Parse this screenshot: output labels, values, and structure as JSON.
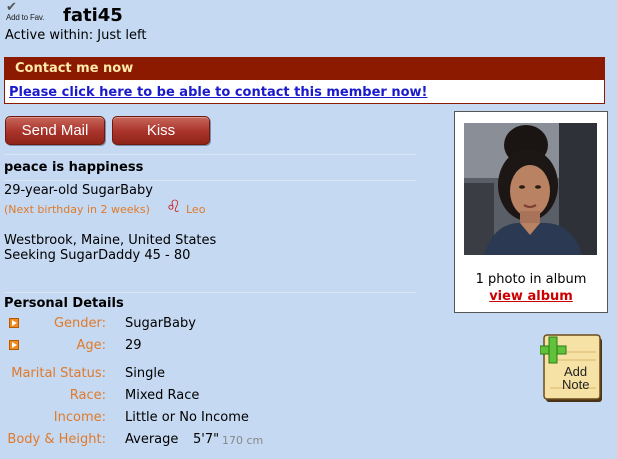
{
  "header": {
    "fav_label": "Add to Fav.",
    "username": "fati45",
    "active_status": "Active within: Just left"
  },
  "contact": {
    "title": "Contact me now",
    "link_text": "Please click here to be able to contact this member now!"
  },
  "buttons": {
    "send_mail": "Send Mail",
    "kiss": "Kiss"
  },
  "profile": {
    "headline": "peace is happiness",
    "age_line": "29-year-old SugarBaby",
    "birthday_note": "(Next birthday in 2 weeks)",
    "zodiac": "Leo",
    "location": "Westbrook, Maine, United States",
    "seeking": "Seeking SugarDaddy 45 - 80"
  },
  "details": {
    "title": "Personal Details",
    "gender_label": "Gender:",
    "gender": "SugarBaby",
    "age_label": "Age:",
    "age": "29",
    "marital_label": "Marital Status:",
    "marital": "Single",
    "race_label": "Race:",
    "race": "Mixed Race",
    "income_label": "Income:",
    "income": "Little or No Income",
    "body_label": "Body & Height:",
    "body": "Average",
    "height": "5'7\"",
    "height_cm": "170 cm"
  },
  "photo": {
    "count_text": "1 photo in album",
    "view_album": "view album"
  },
  "note": {
    "line1": "Add",
    "line2": "Note"
  },
  "colors": {
    "page_bg": "#c5d9f2",
    "accent_dark_red": "#8b1a00",
    "label_orange": "#e07a2a",
    "link_blue": "#1a1acc",
    "album_red": "#cc0000"
  }
}
